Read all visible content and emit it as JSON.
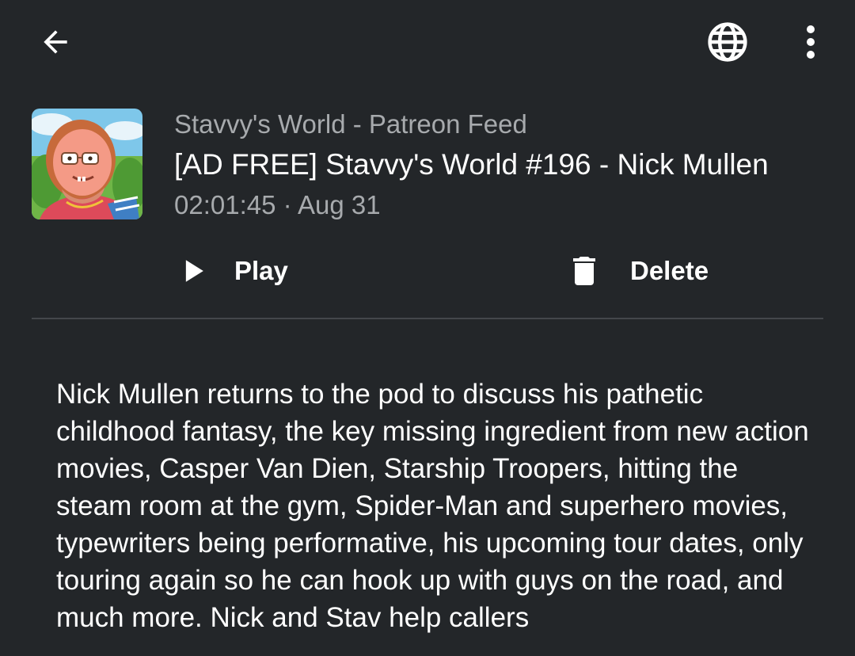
{
  "appbar": {
    "back_icon": "arrow-left-icon",
    "globe_icon": "globe-icon",
    "more_icon": "more-vert-icon"
  },
  "episode": {
    "cover_icon": "podcast-cover-art",
    "podcast_title": "Stavvy's World - Patreon Feed",
    "title": "[AD FREE] Stavvy's World #196 - Nick Mullen",
    "meta": "02:01:45 · Aug 31"
  },
  "actions": {
    "play_label": "Play",
    "play_icon": "play-icon",
    "delete_label": "Delete",
    "delete_icon": "trash-icon"
  },
  "description": "Nick Mullen returns to the pod to discuss his pathetic childhood fantasy, the key missing ingredient from new action movies, Casper Van Dien, Starship Troopers, hitting the steam room at the gym, Spider-Man and superhero movies, typewriters being performative, his upcoming tour dates, only touring again so he can hook up with guys on the road, and much more. Nick and Stav help callers",
  "colors": {
    "background": "#232629",
    "secondary_text": "#a7aaad",
    "divider": "#44474b"
  }
}
